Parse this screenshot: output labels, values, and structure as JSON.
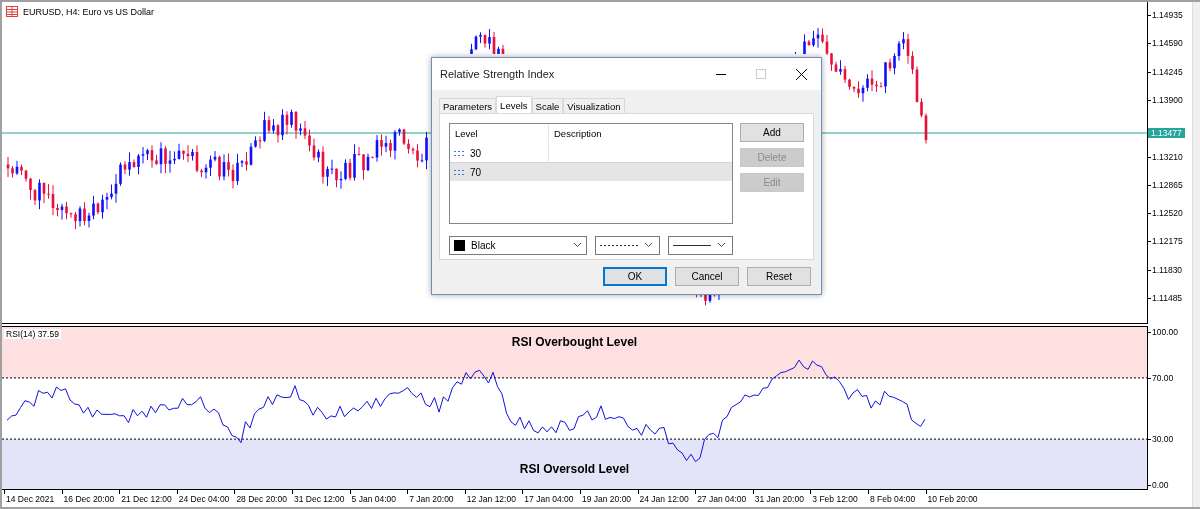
{
  "chart": {
    "title": "EURUSD, H4:  Euro vs US Dollar",
    "price_ticks": [
      "1.14935",
      "1.14590",
      "1.14245",
      "1.13900",
      "1.13210",
      "1.12865",
      "1.12520",
      "1.12175",
      "1.11830",
      "1.11485"
    ],
    "current_price": "1.13477",
    "indicator": {
      "label": "RSI(14) 37.59",
      "overbought_label": "RSI Overbought Level",
      "oversold_label": "RSI Oversold Level",
      "ticks": [
        "100.00",
        "70.00",
        "30.00",
        "0.00"
      ]
    },
    "time_ticks": [
      "14 Dec 2021",
      "16 Dec 20:00",
      "21 Dec 12:00",
      "24 Dec 04:00",
      "28 Dec 20:00",
      "31 Dec 12:00",
      "5 Jan 04:00",
      "7 Jan 20:00",
      "12 Jan 12:00",
      "17 Jan 04:00",
      "19 Jan 20:00",
      "24 Jan 12:00",
      "27 Jan 04:00",
      "31 Jan 20:00",
      "3 Feb 12:00",
      "8 Feb 04:00",
      "10 Feb 20:00"
    ]
  },
  "dialog": {
    "title": "Relative Strength Index",
    "tabs": [
      {
        "label": "Parameters",
        "selected": false
      },
      {
        "label": "Levels",
        "selected": true
      },
      {
        "label": "Scale",
        "selected": false
      },
      {
        "label": "Visualization",
        "selected": false
      }
    ],
    "columns": [
      "Level",
      "Description"
    ],
    "rows": [
      {
        "level": "30",
        "selected": false
      },
      {
        "level": "70",
        "selected": true
      }
    ],
    "side_buttons": [
      {
        "label": "Add",
        "disabled": false
      },
      {
        "label": "Delete",
        "disabled": true
      },
      {
        "label": "Edit",
        "disabled": true
      }
    ],
    "color_select": "Black",
    "footer_buttons": [
      {
        "label": "OK",
        "default": true
      },
      {
        "label": "Cancel",
        "default": false
      },
      {
        "label": "Reset",
        "default": false
      }
    ]
  }
}
